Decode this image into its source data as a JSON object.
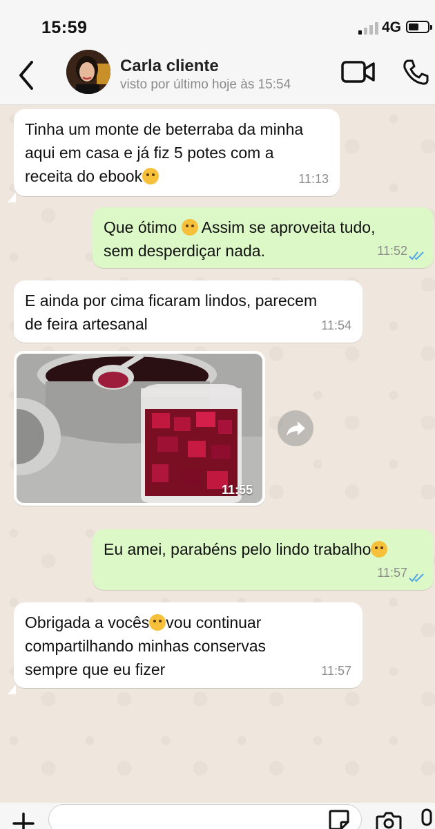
{
  "status_bar": {
    "time": "15:59",
    "network": "4G"
  },
  "header": {
    "contact_name": "Carla cliente",
    "last_seen": "visto por último hoje às 15:54"
  },
  "messages": [
    {
      "direction": "in",
      "lines": [
        "Tinha um monte de beterraba da minha",
        "aqui em casa e já fiz 5 potes com a",
        "receita do ebook"
      ],
      "emoji": "smiling-face-with-hearts",
      "time": "11:13"
    },
    {
      "direction": "out",
      "lines": [
        "Que ótimo ",
        " Assim se aproveita tudo,",
        "sem desperdiçar nada."
      ],
      "emoji": "smiling-face",
      "time": "11:52",
      "status": "read"
    },
    {
      "direction": "in",
      "lines": [
        "E ainda por cima ficaram lindos, parecem",
        "de feira artesanal"
      ],
      "time": "11:54"
    },
    {
      "direction": "in",
      "type": "image",
      "image_description": "pickled beets in glass jar",
      "time": "11:55"
    },
    {
      "direction": "out",
      "lines": [
        "Eu amei, parabéns pelo lindo trabalho"
      ],
      "emoji": "pleading-face",
      "time": "11:57",
      "status": "read"
    },
    {
      "direction": "in",
      "lines": [
        "Obrigada a vocês",
        "vou continuar",
        "compartilhando minhas conservas",
        "sempre que eu fizer"
      ],
      "emoji": "face-blowing-kiss",
      "time": "11:57"
    }
  ],
  "composer": {
    "placeholder": ""
  },
  "colors": {
    "incoming_bubble": "#ffffff",
    "outgoing_bubble": "#dcf8c6",
    "chat_background": "#efe7dd",
    "read_ticks": "#4fa6e6"
  },
  "icons": [
    "back-arrow-icon",
    "video-call-icon",
    "phone-icon",
    "forward-icon",
    "plus-icon",
    "sticker-icon",
    "camera-icon",
    "microphone-icon",
    "double-check-icon"
  ]
}
